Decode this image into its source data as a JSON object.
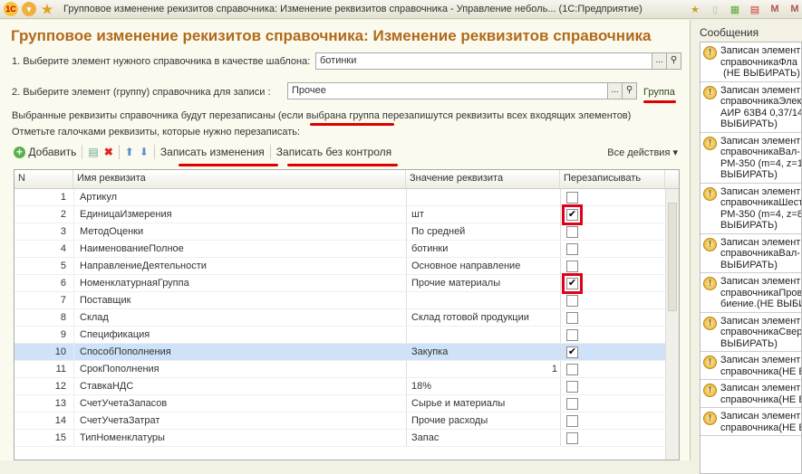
{
  "window": {
    "title": "Групповое изменение рекизитов  справочника: Изменение реквизитов справочника - Управление неболь... (1С:Предприятие)"
  },
  "form": {
    "title": "Групповое изменение рекизитов  справочника: Изменение реквизитов справочника",
    "step1_label": "1. Выберите элемент нужного справочника в качестве шаблона:",
    "step1_value": "ботинки",
    "step2_label": "2. Выберите  элемент  (группу)  справочника  для  записи  :",
    "step2_value": "Прочее",
    "group_link": "Группа",
    "info_part1": "Выбранные реквизиты   справочника будут перезаписаны (если ",
    "info_highlight": "выбрана группа",
    "info_part2": "  перезапишутся реквизиты всех входящих элементов)",
    "hint": "Отметьте галочками реквизиты, которые нужно перезаписать:",
    "select_button": "...",
    "search_icon": "search-icon"
  },
  "toolbar": {
    "add": "Добавить",
    "write_changes": "Записать изменения",
    "write_no_control": "Записать без контроля",
    "all_actions": "Все действия ▾"
  },
  "table": {
    "headers": [
      "N",
      "Имя реквизита",
      "Значение реквизита",
      "Перезаписывать"
    ],
    "rows": [
      {
        "n": "1",
        "name": "Артикул",
        "value": "",
        "checked": false
      },
      {
        "n": "2",
        "name": "ЕдиницаИзмерения",
        "value": "шт",
        "checked": true,
        "highlight": true
      },
      {
        "n": "3",
        "name": "МетодОценки",
        "value": "По средней",
        "checked": false
      },
      {
        "n": "4",
        "name": "НаименованиеПолное",
        "value": "ботинки",
        "checked": false
      },
      {
        "n": "5",
        "name": "НаправлениеДеятельности",
        "value": "Основное направление",
        "checked": false
      },
      {
        "n": "6",
        "name": "НоменклатурнаяГруппа",
        "value": "Прочие материалы",
        "checked": true,
        "highlight": true
      },
      {
        "n": "7",
        "name": "Поставщик",
        "value": "",
        "checked": false
      },
      {
        "n": "8",
        "name": "Склад",
        "value": "Склад готовой продукции",
        "checked": false
      },
      {
        "n": "9",
        "name": "Спецификация",
        "value": "",
        "checked": false
      },
      {
        "n": "10",
        "name": "СпособПополнения",
        "value": "Закупка",
        "checked": true,
        "selected": true
      },
      {
        "n": "11",
        "name": "СрокПополнения",
        "value": "1",
        "numeric": true,
        "checked": false
      },
      {
        "n": "12",
        "name": "СтавкаНДС",
        "value": "18%",
        "checked": false
      },
      {
        "n": "13",
        "name": "СчетУчетаЗапасов",
        "value": "Сырье и материалы",
        "checked": false
      },
      {
        "n": "14",
        "name": "СчетУчетаЗатрат",
        "value": "Прочие расходы",
        "checked": false
      },
      {
        "n": "15",
        "name": "ТипНоменклатуры",
        "value": "Запас",
        "checked": false
      }
    ]
  },
  "messages": {
    "title": "Сообщения",
    "items": [
      "Записан элемент\nсправочникаФла\n (НЕ ВЫБИРАТЬ)",
      "Записан элемент\nсправочникаЭлек\nАИР 63В4 0,37/14\nВЫБИРАТЬ)",
      "Записан элемент\nсправочникаВал-\nРМ-350 (m=4, z=19\nВЫБИРАТЬ)",
      "Записан элемент\nсправочникаШест\nРМ-350 (m=4, z=83\nВЫБИРАТЬ)",
      "Записан элемент\nсправочникаВал-\nВЫБИРАТЬ)",
      "Записан элемент\nсправочникаПров\nбиение.(НЕ ВЫБИ",
      "Записан элемент\nсправочникаСвер\nВЫБИРАТЬ)",
      "Записан элемент\nсправочника(НЕ В",
      "Записан элемент\nсправочника(НЕ В",
      "Записан элемент\nсправочника(НЕ В"
    ]
  }
}
